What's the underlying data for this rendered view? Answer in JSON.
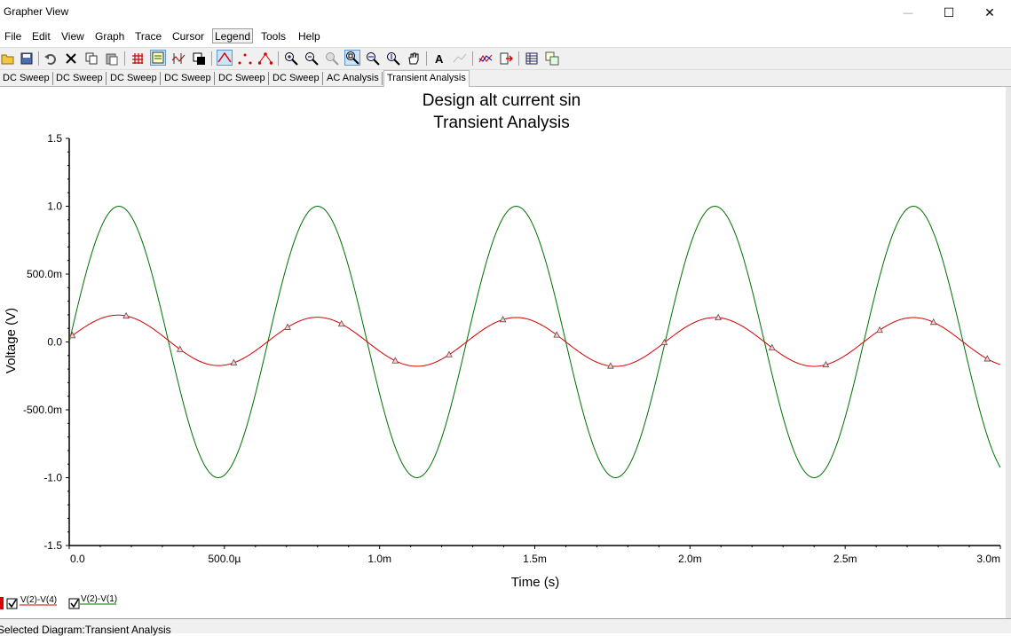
{
  "window": {
    "title": "Grapher View",
    "controls": {
      "minimize": "—",
      "maximize": "☐",
      "close": "✕"
    }
  },
  "menu": [
    "File",
    "Edit",
    "View",
    "Graph",
    "Trace",
    "Cursor",
    "Legend",
    "Tools",
    "Help"
  ],
  "menu_selected": "Legend",
  "toolbar_icons": [
    "open-icon",
    "save-icon",
    "undo-icon",
    "cut-icon",
    "copy-icon",
    "paste-icon",
    "grid-icon",
    "legend-icon",
    "cursors-icon",
    "reverse-colors-icon",
    "line-trace-icon",
    "dots-trace-icon",
    "markers-trace-icon",
    "zoom-in-icon",
    "zoom-out-icon",
    "zoom-full-icon",
    "zoom-area-icon",
    "zoom-x-icon",
    "zoom-y-icon",
    "pan-icon",
    "text-icon",
    "label-icon",
    "overlay-traces-icon",
    "export-icon",
    "properties-icon",
    "copy-graph-icon"
  ],
  "tabs": [
    "DC Sweep",
    "DC Sweep",
    "DC Sweep",
    "DC Sweep",
    "DC Sweep",
    "DC Sweep",
    "AC Analysis",
    "Transient Analysis"
  ],
  "active_tab": "Transient Analysis",
  "chart_data": {
    "type": "line",
    "title": "Design alt current sin",
    "subtitle": "Transient Analysis",
    "xlabel": "Time (s)",
    "ylabel": "Voltage (V)",
    "xlim": [
      0,
      0.003
    ],
    "ylim": [
      -1.5,
      1.5
    ],
    "grid": false,
    "x_ticks": [
      0,
      0.0005,
      0.001,
      0.0015,
      0.002,
      0.0025,
      0.003
    ],
    "x_tick_labels": [
      "0.0",
      "500.0µ",
      "1.0m",
      "1.5m",
      "2.0m",
      "2.5m",
      "3.0m"
    ],
    "y_ticks": [
      1.5,
      1.0,
      0.5,
      0.0,
      -0.5,
      -1.0,
      -1.5
    ],
    "y_tick_labels": [
      "1.5",
      "1.0",
      "500.0m",
      "0.0",
      "-500.0m",
      "-1.0",
      "-1.5"
    ],
    "series": [
      {
        "name": "V(2)-V(4)",
        "color": "#d40000",
        "marker": "triangle",
        "amplitude": 0.18,
        "frequency": 1562.5,
        "phase_deg": 0,
        "initial_offset": 0.03,
        "offset_decay_tau": 0.0003
      },
      {
        "name": "V(2)-V(1)",
        "color": "#007000",
        "marker": "none",
        "amplitude": 1.0,
        "frequency": 1562.5,
        "phase_deg": 0
      }
    ]
  },
  "legend": [
    {
      "label": "V(2)-V(4)",
      "checked": true,
      "color": "#d40000"
    },
    {
      "label": "V(2)-V(1)",
      "checked": true,
      "color": "#007000"
    }
  ],
  "status": {
    "text": "Selected Diagram:Transient Analysis"
  }
}
